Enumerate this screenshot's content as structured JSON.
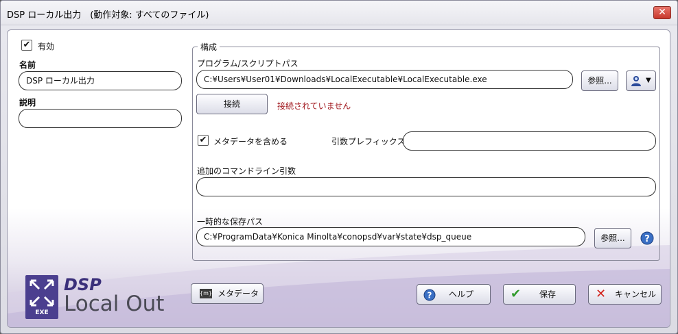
{
  "window": {
    "title": "DSP ローカル出力　(動作対象: すべてのファイル)",
    "close_glyph": "✕"
  },
  "left": {
    "enabled_label": "有効",
    "enabled_check": "✔",
    "name_label": "名前",
    "name_value": "DSP ローカル出力",
    "description_label": "説明",
    "description_value": ""
  },
  "config": {
    "legend": "構成",
    "program_path_label": "プログラム/スクリプトパス",
    "program_path_value": "C:¥Users¥User01¥Downloads¥LocalExecutable¥LocalExecutable.exe",
    "browse_label": "参照...",
    "connect_label": "接続",
    "connection_status": "接続されていません",
    "include_metadata_label": "メタデータを含める",
    "include_metadata_check": "✔",
    "arg_prefix_label": "引数プレフィックス",
    "arg_prefix_value": "",
    "extra_args_label": "追加のコマンドライン引数",
    "extra_args_value": "",
    "temp_path_label": "一時的な保存パス",
    "temp_path_value": "C:¥ProgramData¥Konica Minolta¥conopsd¥var¥state¥dsp_queue",
    "temp_browse_label": "参照..."
  },
  "footer": {
    "logo_line1": "DSP",
    "logo_line2": "Local Out",
    "logo_badge": "EXE",
    "metadata_button": "メタデータ",
    "help_button": "ヘルプ",
    "save_button": "保存",
    "cancel_button": "キャンセル"
  },
  "colors": {
    "status_red": "#a0161c",
    "logo_purple": "#3a2f7a"
  }
}
